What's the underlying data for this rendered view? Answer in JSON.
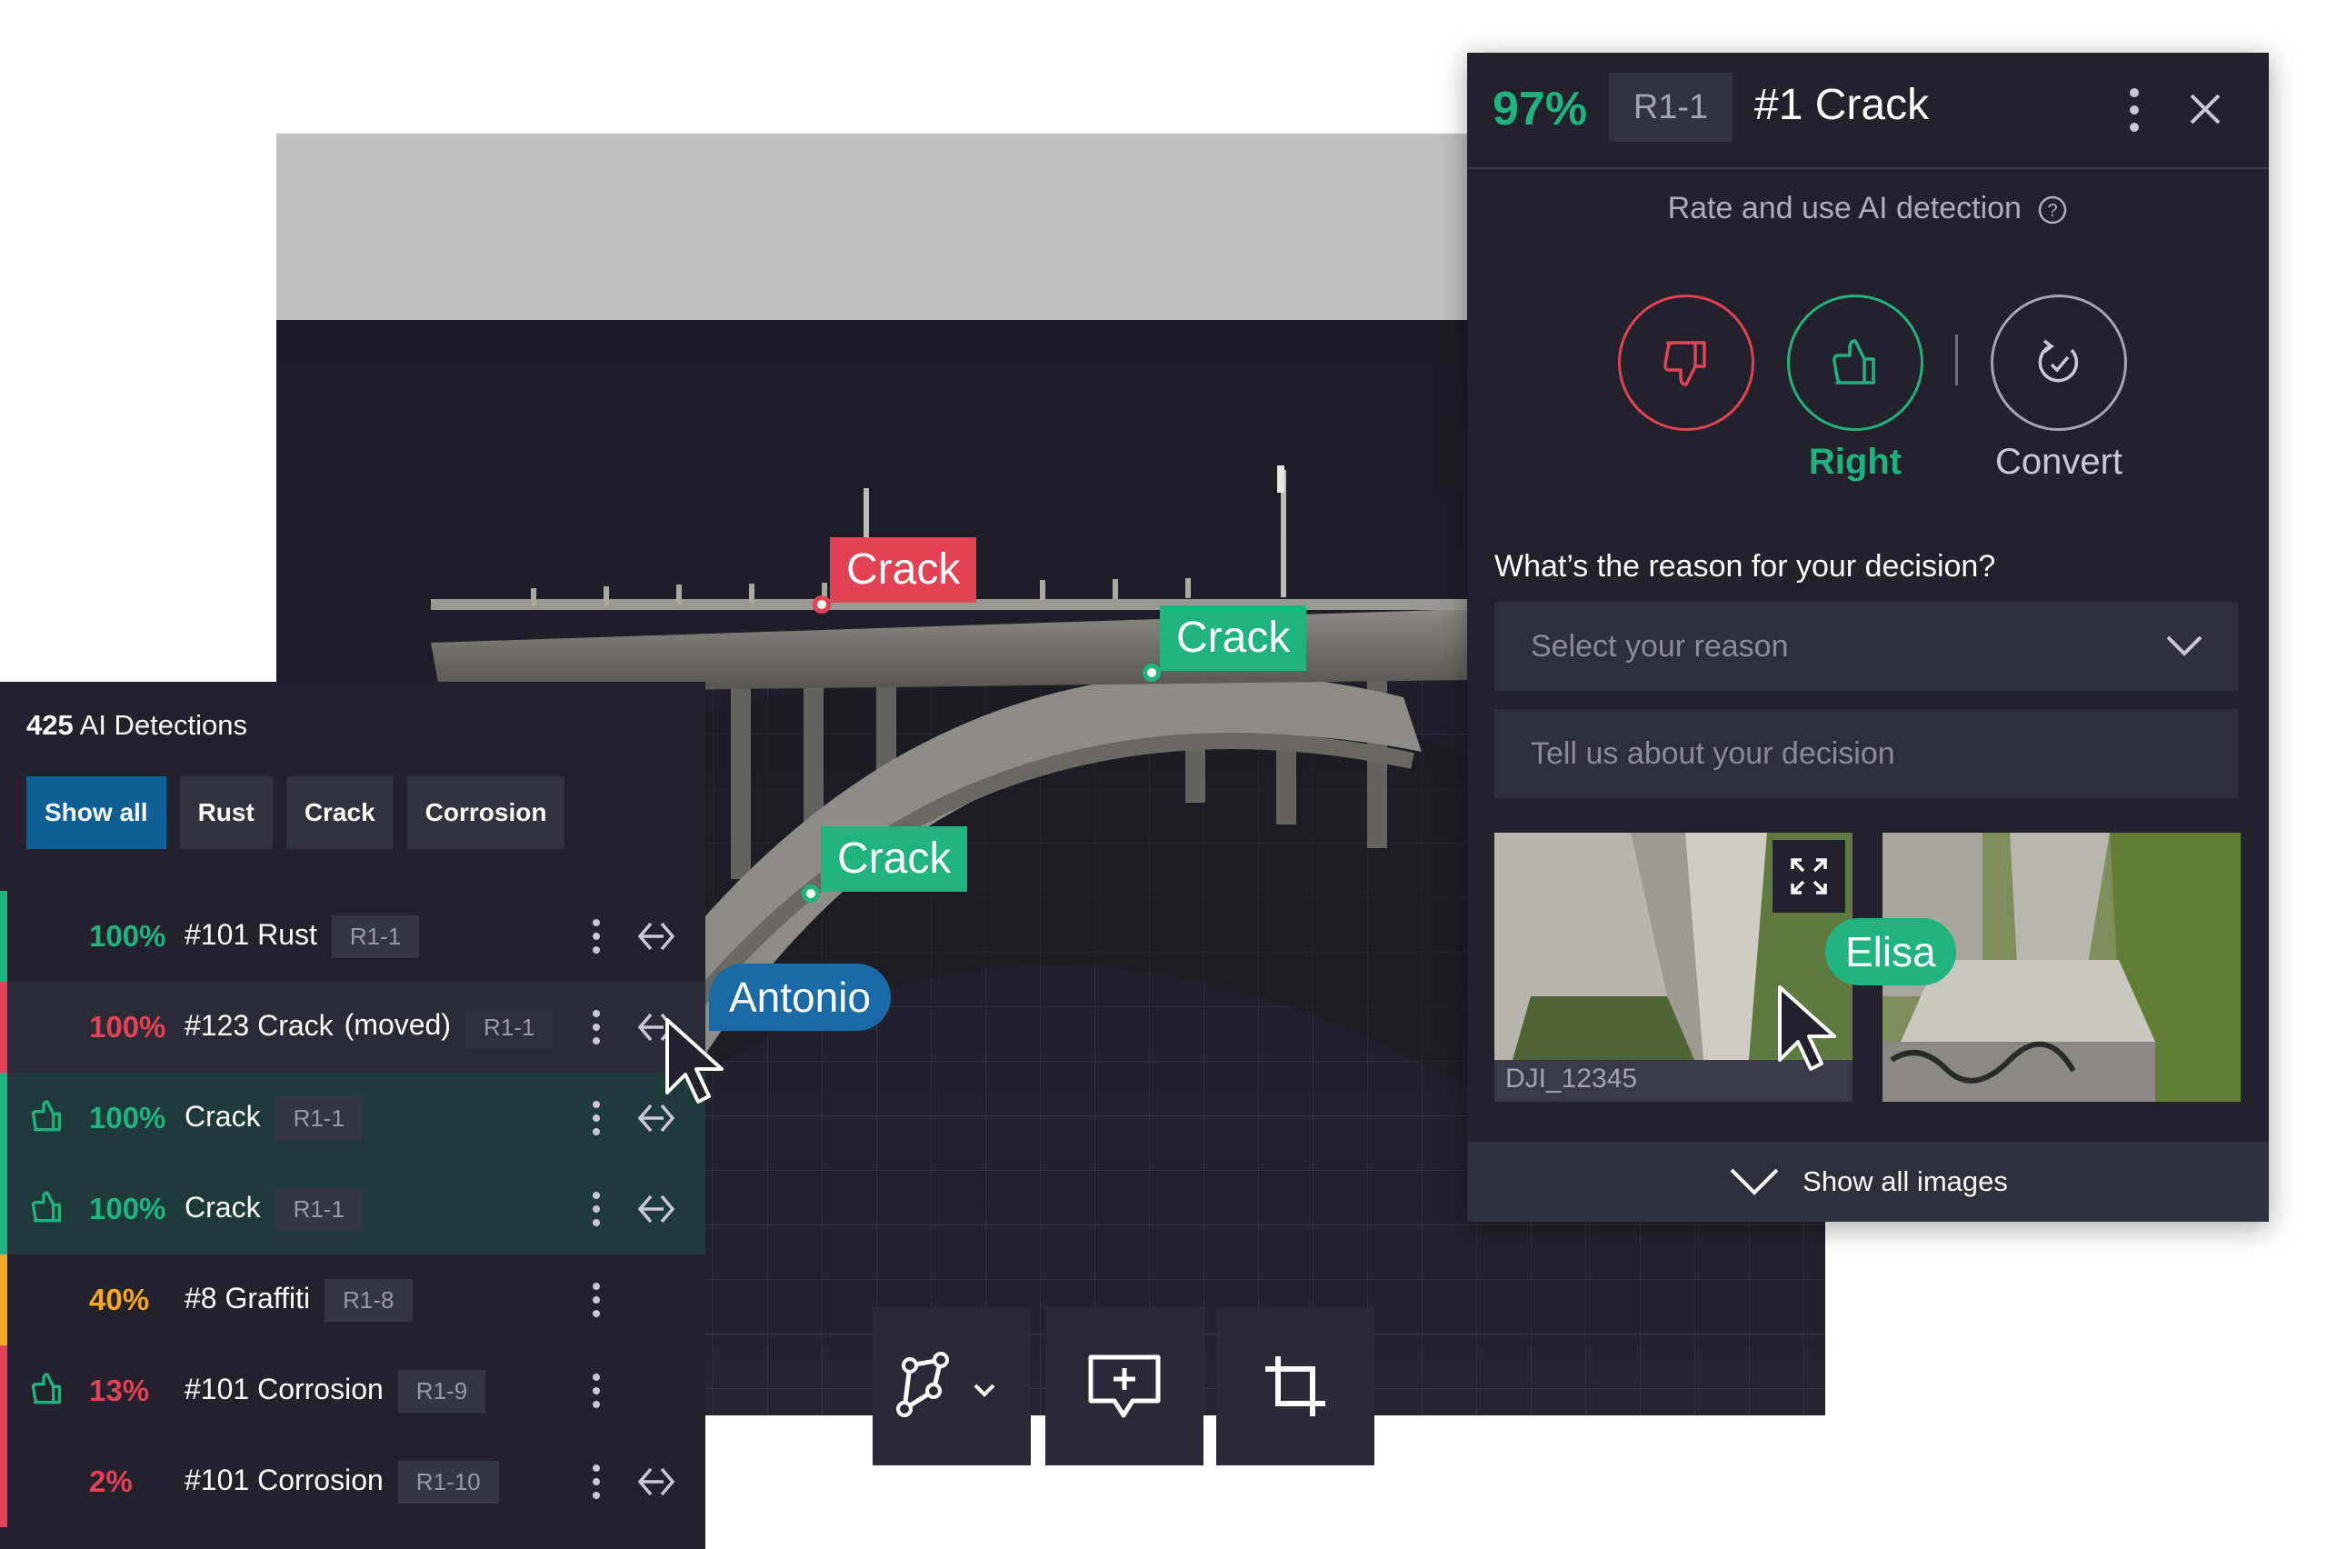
{
  "viewport": {
    "labels": [
      "Crack",
      "Crack",
      "Crack"
    ],
    "comment_author": "Antonio"
  },
  "toolbar": {
    "tools": [
      "polyline-tool-icon",
      "add-comment-icon",
      "crop-icon"
    ]
  },
  "detections": {
    "count": "425",
    "count_label": "AI Detections",
    "filters": [
      "Show all",
      "Rust",
      "Crack",
      "Corrosion"
    ],
    "active_filter": "Show all",
    "rows": [
      {
        "pct": "100%",
        "name": "#101 Rust",
        "version": "R1-1",
        "status": "green"
      },
      {
        "pct": "100%",
        "name": "#123 Crack",
        "note": "(moved)",
        "version": "R1-1",
        "status": "red"
      },
      {
        "pct": "100%",
        "name": "Crack",
        "version": "R1-1",
        "status": "green",
        "rated": "thumbs-up"
      },
      {
        "pct": "100%",
        "name": "Crack",
        "version": "R1-1",
        "status": "green",
        "rated": "thumbs-up"
      },
      {
        "pct": "40%",
        "name": "#8 Graffiti",
        "version": "R1-8",
        "status": "orange"
      },
      {
        "pct": "13%",
        "name": "#101 Corrosion",
        "version": "R1-9",
        "status": "red",
        "rated": "thumbs-up"
      },
      {
        "pct": "2%",
        "name": "#101 Corrosion",
        "version": "R1-10",
        "status": "red"
      }
    ]
  },
  "detail": {
    "confidence": "97%",
    "version": "R1-1",
    "title": "#1 Crack",
    "rate_prompt": "Rate and use AI detection",
    "right_label": "Right",
    "convert_label": "Convert",
    "question": "What’s the reason for your decision?",
    "reason_placeholder": "Select your reason",
    "comment_placeholder": "Tell us about your decision",
    "image_caption": "DJI_12345",
    "collaborator": "Elisa",
    "show_all_images": "Show all images"
  },
  "colors": {
    "green": "#1fb37f",
    "red": "#e24253",
    "orange": "#f5a623",
    "blue": "#0f5f98",
    "panel": "#22212c"
  }
}
